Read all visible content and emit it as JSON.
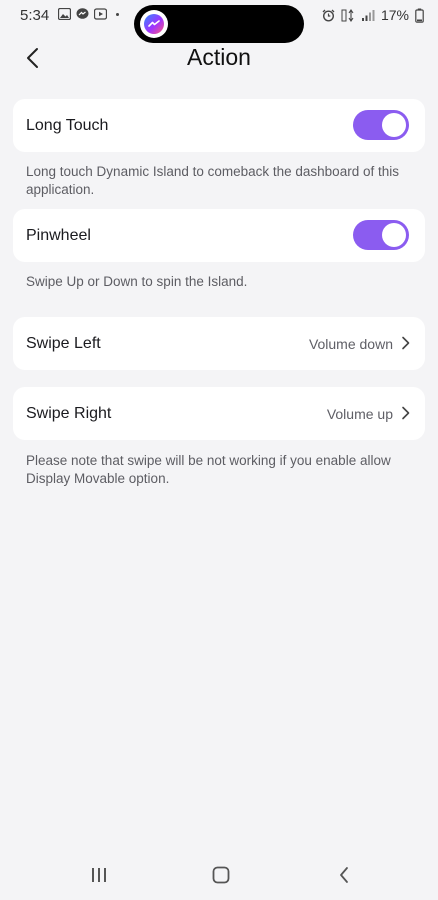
{
  "status_bar": {
    "time": "5:34",
    "battery": "17%"
  },
  "header": {
    "title": "Action"
  },
  "settings": {
    "long_touch": {
      "label": "Long Touch",
      "enabled": true,
      "description": "Long touch Dynamic Island to comeback the dashboard of this application."
    },
    "pinwheel": {
      "label": "Pinwheel",
      "enabled": true,
      "description": "Swipe Up or Down to spin the Island."
    },
    "swipe_left": {
      "label": "Swipe Left",
      "value": "Volume down"
    },
    "swipe_right": {
      "label": "Swipe Right",
      "value": "Volume up"
    },
    "note": "Please note that swipe will be not working if you enable allow Display Movable option."
  },
  "colors": {
    "accent": "#8b5cf0",
    "background": "#f4f4f6",
    "card": "#ffffff"
  },
  "icons": {
    "back": "chevron-left-icon",
    "item_chevron": "chevron-right-icon",
    "nav_recents": "recents-icon",
    "nav_home": "home-icon",
    "nav_back": "back-icon"
  }
}
